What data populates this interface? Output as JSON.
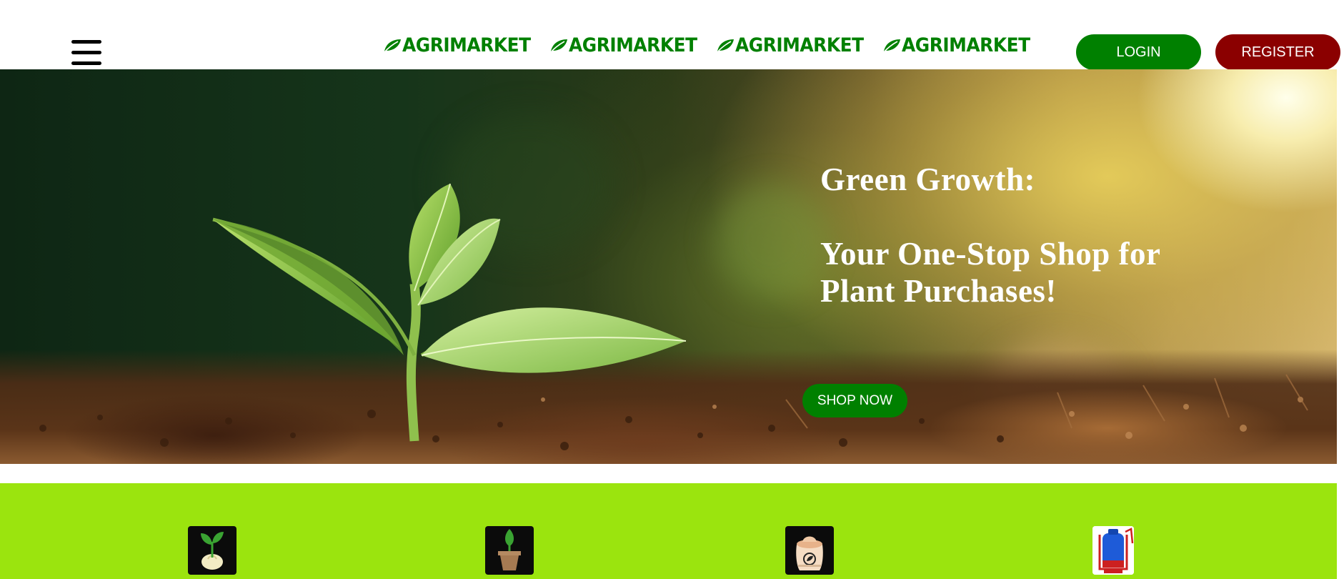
{
  "header": {
    "menu_icon": "hamburger-menu-icon",
    "brand_text": "AGRIMARKET",
    "brand_icon": "leaf-icon",
    "brand_links": [
      {
        "label": "AGRIMARKET"
      },
      {
        "label": "AGRIMARKET"
      },
      {
        "label": "AGRIMARKET"
      },
      {
        "label": "AGRIMARKET"
      }
    ],
    "login_label": "LOGIN",
    "register_label": "REGISTER"
  },
  "hero": {
    "title_line1": "Green Growth:",
    "title_line2": "Your One-Stop Shop for Plant Purchases!",
    "cta_label": "SHOP NOW"
  },
  "categories": {
    "items": [
      {
        "icon": "seed-sprout-icon"
      },
      {
        "icon": "potted-plant-icon"
      },
      {
        "icon": "fertilizer-sack-icon"
      },
      {
        "icon": "sprayer-tank-icon"
      }
    ]
  },
  "colors": {
    "brand_green": "#008000",
    "register_red": "#8b0000",
    "category_band": "#9be40e"
  }
}
